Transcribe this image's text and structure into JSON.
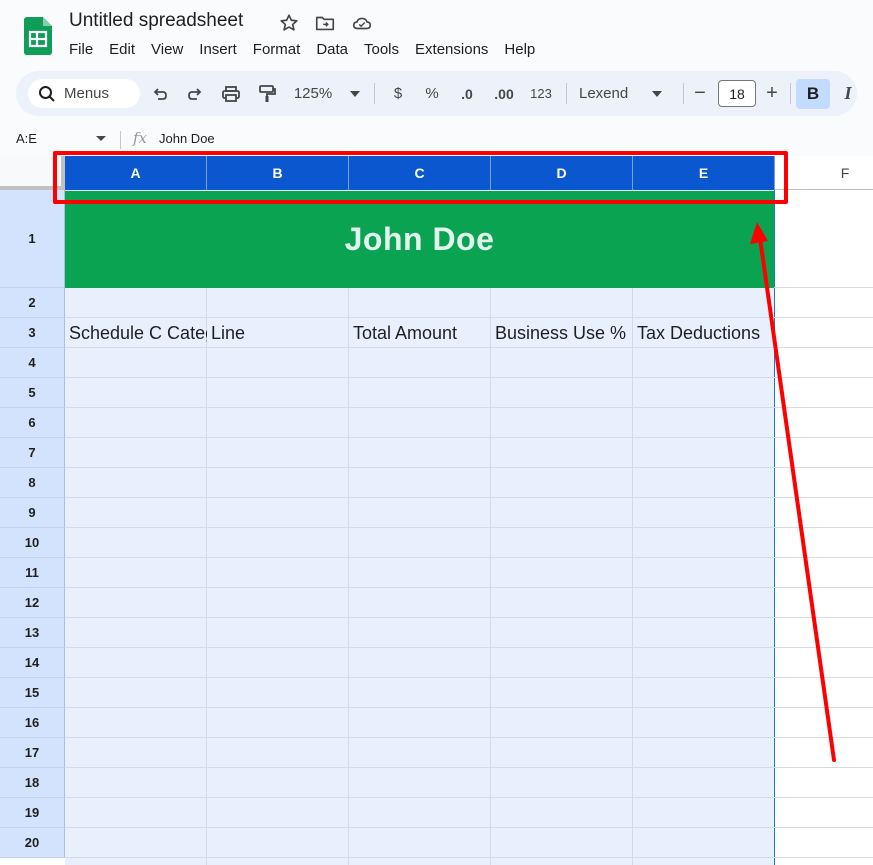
{
  "app": {
    "doc_title": "Untitled spreadsheet",
    "menu": [
      "File",
      "Edit",
      "View",
      "Insert",
      "Format",
      "Data",
      "Tools",
      "Extensions",
      "Help"
    ]
  },
  "toolbar": {
    "search_label": "Menus",
    "zoom": "125%",
    "currency": "$",
    "percent": "%",
    "decrease_decimal": ".0",
    "increase_decimal": ".00",
    "more_formats": "123",
    "font": "Lexend",
    "font_size": "18",
    "minus": "−",
    "plus": "+",
    "bold": "B",
    "italic": "I"
  },
  "formula_bar": {
    "name_box": "A:E",
    "fx": "fx",
    "value": "John Doe"
  },
  "sheet": {
    "columns": [
      "A",
      "B",
      "C",
      "D",
      "E",
      "F"
    ],
    "rows": [
      "1",
      "2",
      "3",
      "4",
      "5",
      "6",
      "7",
      "8",
      "9",
      "10",
      "11",
      "12",
      "13",
      "14",
      "15",
      "16",
      "17",
      "18",
      "19",
      "20"
    ],
    "title_cell": "John Doe",
    "row3": [
      "Schedule C Category",
      "Line",
      "Total Amount",
      "Business Use %",
      "Tax Deductions"
    ]
  },
  "colors": {
    "selected_header": "#0b57d0",
    "title_fill": "#0aa352",
    "annotation": "#ff0000",
    "selection_fill": "#e8f0fe"
  }
}
